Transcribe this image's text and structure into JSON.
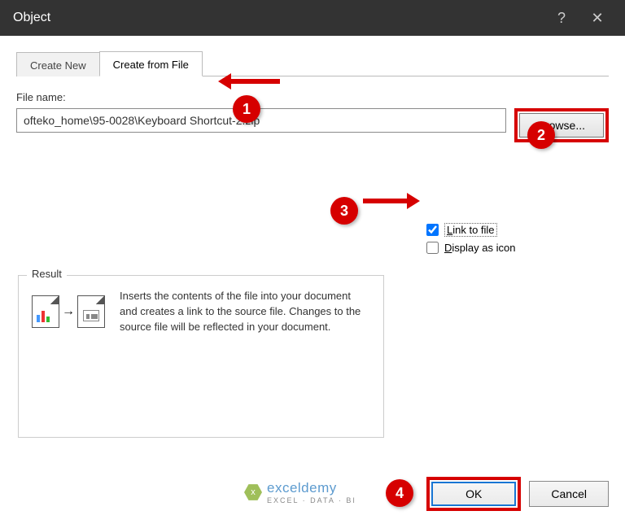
{
  "titlebar": {
    "title": "Object"
  },
  "tabs": {
    "create_new": "Create New",
    "create_from_file": "Create from File"
  },
  "file_section": {
    "label": "File name:",
    "value": "ofteko_home\\95-0028\\Keyboard Shortcut-2.zip",
    "browse_prefix": "B",
    "browse_rest": "rowse..."
  },
  "checks": {
    "link_prefix": "L",
    "link_rest": "ink to file",
    "display_prefix": "D",
    "display_rest": "isplay as icon",
    "link_checked": true,
    "display_checked": false
  },
  "result": {
    "legend": "Result",
    "text": "Inserts the contents of the file into your document and creates a link to the source file. Changes to the source file will be reflected in your document."
  },
  "buttons": {
    "ok": "OK",
    "cancel": "Cancel"
  },
  "annotations": {
    "b1": "1",
    "b2": "2",
    "b3": "3",
    "b4": "4"
  },
  "watermark": {
    "brand": "exceldemy",
    "sub": "EXCEL · DATA · BI"
  }
}
